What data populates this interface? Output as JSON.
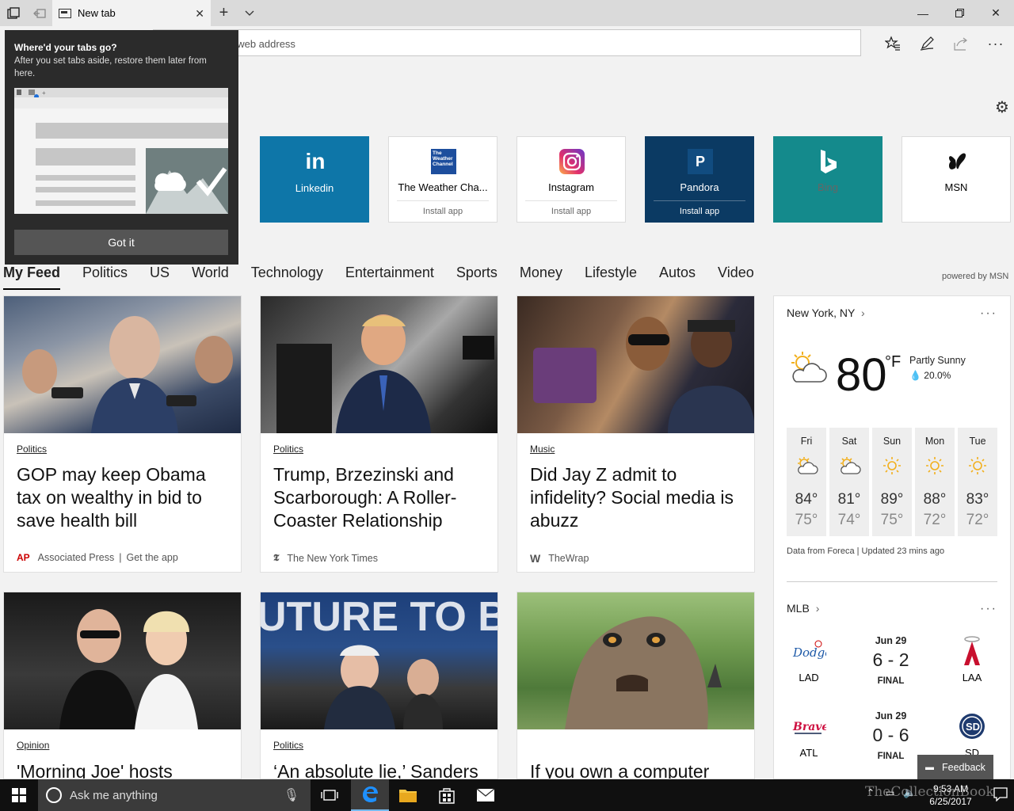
{
  "browser": {
    "tab_title": "New tab",
    "address_placeholder": "Search or enter web address"
  },
  "popup": {
    "title": "Where'd your tabs go?",
    "description": "After you set tabs aside, restore them later from here.",
    "button": "Got it"
  },
  "top_sites": [
    {
      "name": "Linkedin",
      "logo_text": "in",
      "bg": "#0e76a8",
      "install": ""
    },
    {
      "name": "The Weather Cha...",
      "logo_text": "The Weather Channel",
      "bg": "#ffffff",
      "install": "Install app"
    },
    {
      "name": "Instagram",
      "logo_text": "",
      "bg": "#ffffff",
      "install": "Install app"
    },
    {
      "name": "Pandora",
      "logo_text": "P",
      "bg": "#0b3a63",
      "install": "Install app"
    },
    {
      "name": "Bing",
      "logo_text": "b",
      "bg": "#148a8c",
      "install": ""
    },
    {
      "name": "MSN",
      "logo_text": "",
      "bg": "#ffffff",
      "install": ""
    }
  ],
  "feed_nav": [
    "My Feed",
    "Politics",
    "US",
    "World",
    "Technology",
    "Entertainment",
    "Sports",
    "Money",
    "Lifestyle",
    "Autos",
    "Video"
  ],
  "powered_by": "powered by MSN",
  "cards": [
    {
      "category": "Politics",
      "headline": "GOP may keep Obama tax on wealthy in bid to save health bill",
      "source_icon": "AP",
      "source": "Associated Press",
      "extra": "Get the app"
    },
    {
      "category": "Politics",
      "headline": "Trump, Brzezinski and Scarborough: A Roller-Coaster Relationship",
      "source_icon": "𝕿",
      "source": "The New York Times",
      "extra": ""
    },
    {
      "category": "Music",
      "headline": "Did Jay Z admit to infidelity? Social media is abuzz",
      "source_icon": "W",
      "source": "TheWrap",
      "extra": ""
    },
    {
      "category": "Opinion",
      "headline": "'Morning Joe' hosts",
      "source_icon": "",
      "source": "",
      "extra": ""
    },
    {
      "category": "Politics",
      "headline": "‘An absolute lie,’ Sanders",
      "source_icon": "",
      "source": "",
      "extra": ""
    },
    {
      "category": "",
      "headline": "If you own a computer",
      "source_icon": "",
      "source": "",
      "extra": ""
    }
  ],
  "weather": {
    "location": "New York, NY",
    "temp": "80",
    "unit": "°F",
    "condition": "Partly Sunny",
    "precip": "20.0%",
    "days": [
      {
        "name": "Fri",
        "high": "84°",
        "low": "75°",
        "icon": "partly-sunny"
      },
      {
        "name": "Sat",
        "high": "81°",
        "low": "74°",
        "icon": "partly-sunny"
      },
      {
        "name": "Sun",
        "high": "89°",
        "low": "75°",
        "icon": "sunny"
      },
      {
        "name": "Mon",
        "high": "88°",
        "low": "72°",
        "icon": "sunny"
      },
      {
        "name": "Tue",
        "high": "83°",
        "low": "72°",
        "icon": "sunny"
      }
    ],
    "source": "Data from Foreca | Updated 23 mins ago"
  },
  "mlb": {
    "title": "MLB",
    "games": [
      {
        "date": "Jun 29",
        "score": "6 - 2",
        "status": "FINAL",
        "home": "LAD",
        "away": "LAA"
      },
      {
        "date": "Jun 29",
        "score": "0 - 6",
        "status": "FINAL",
        "home": "ATL",
        "away": "SD"
      }
    ]
  },
  "feedback": "Feedback",
  "taskbar": {
    "search_placeholder": "Ask me anything",
    "time": "9:53 AM",
    "date": "6/25/2017"
  },
  "watermark": "TheCollectionBook",
  "colors": {
    "accent": "#0078d7",
    "popup_bg": "#2b2b2b"
  }
}
